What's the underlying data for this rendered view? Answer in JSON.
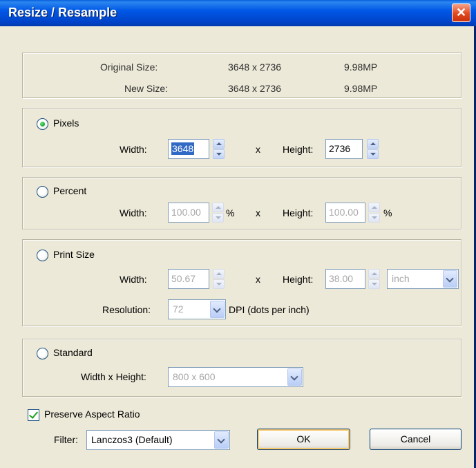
{
  "window": {
    "title": "Resize / Resample",
    "close_glyph": "✕"
  },
  "info": {
    "original_label": "Original Size:",
    "original_dims": "3648 x 2736",
    "original_mp": "9.98MP",
    "new_label": "New Size:",
    "new_dims": "3648 x 2736",
    "new_mp": "9.98MP"
  },
  "pixels": {
    "label": "Pixels",
    "selected": true,
    "width_label": "Width:",
    "width_value": "3648",
    "x_sep": "x",
    "height_label": "Height:",
    "height_value": "2736"
  },
  "percent": {
    "label": "Percent",
    "selected": false,
    "width_label": "Width:",
    "width_value": "100.00",
    "width_unit": "%",
    "x_sep": "x",
    "height_label": "Height:",
    "height_value": "100.00",
    "height_unit": "%"
  },
  "print_size": {
    "label": "Print Size",
    "selected": false,
    "width_label": "Width:",
    "width_value": "50.67",
    "x_sep": "x",
    "height_label": "Height:",
    "height_value": "38.00",
    "unit_value": "inch",
    "resolution_label": "Resolution:",
    "resolution_value": "72",
    "resolution_unit": "DPI (dots per inch)"
  },
  "standard": {
    "label": "Standard",
    "selected": false,
    "wh_label": "Width x Height:",
    "wh_value": "800 x 600"
  },
  "preserve_aspect": {
    "label": "Preserve Aspect Ratio",
    "checked": true
  },
  "filter": {
    "label": "Filter:",
    "value": "Lanczos3 (Default)"
  },
  "buttons": {
    "ok": "OK",
    "cancel": "Cancel"
  },
  "colors": {
    "title_bar": "#0058e6",
    "dialog_bg": "#ece9d8",
    "selection": "#316ac5"
  }
}
